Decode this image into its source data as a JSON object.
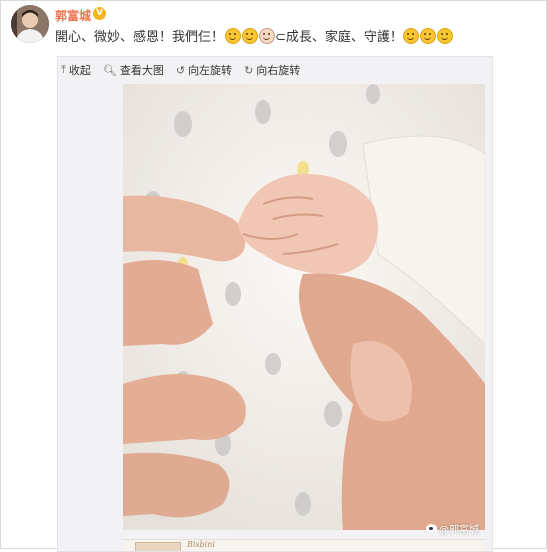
{
  "user": {
    "name": "郭富城",
    "verified_badge": "V"
  },
  "post": {
    "text_part1": "開心、微妙、感恩！我們仨！",
    "text_part2": "⊂成長、家庭、守護！",
    "emoji_icons": [
      "smile-emoji",
      "smile-emoji",
      "baby-emoji",
      "smile-emoji",
      "smile-emoji",
      "smile-emoji"
    ]
  },
  "toolbar": {
    "collapse_label": "收起",
    "view_large_label": "查看大图",
    "rotate_left_label": "向左旋转",
    "rotate_right_label": "向右旋转"
  },
  "photo": {
    "watermark": "@郭富城",
    "description_icon": "baby-hand-holding-fingers"
  },
  "thumbnail": {
    "script_text": "Bisbini"
  },
  "colors": {
    "username": "#eb7350",
    "badge": "#f5b321",
    "card_bg": "#f2f2f5",
    "emoji": "#f8c630"
  }
}
